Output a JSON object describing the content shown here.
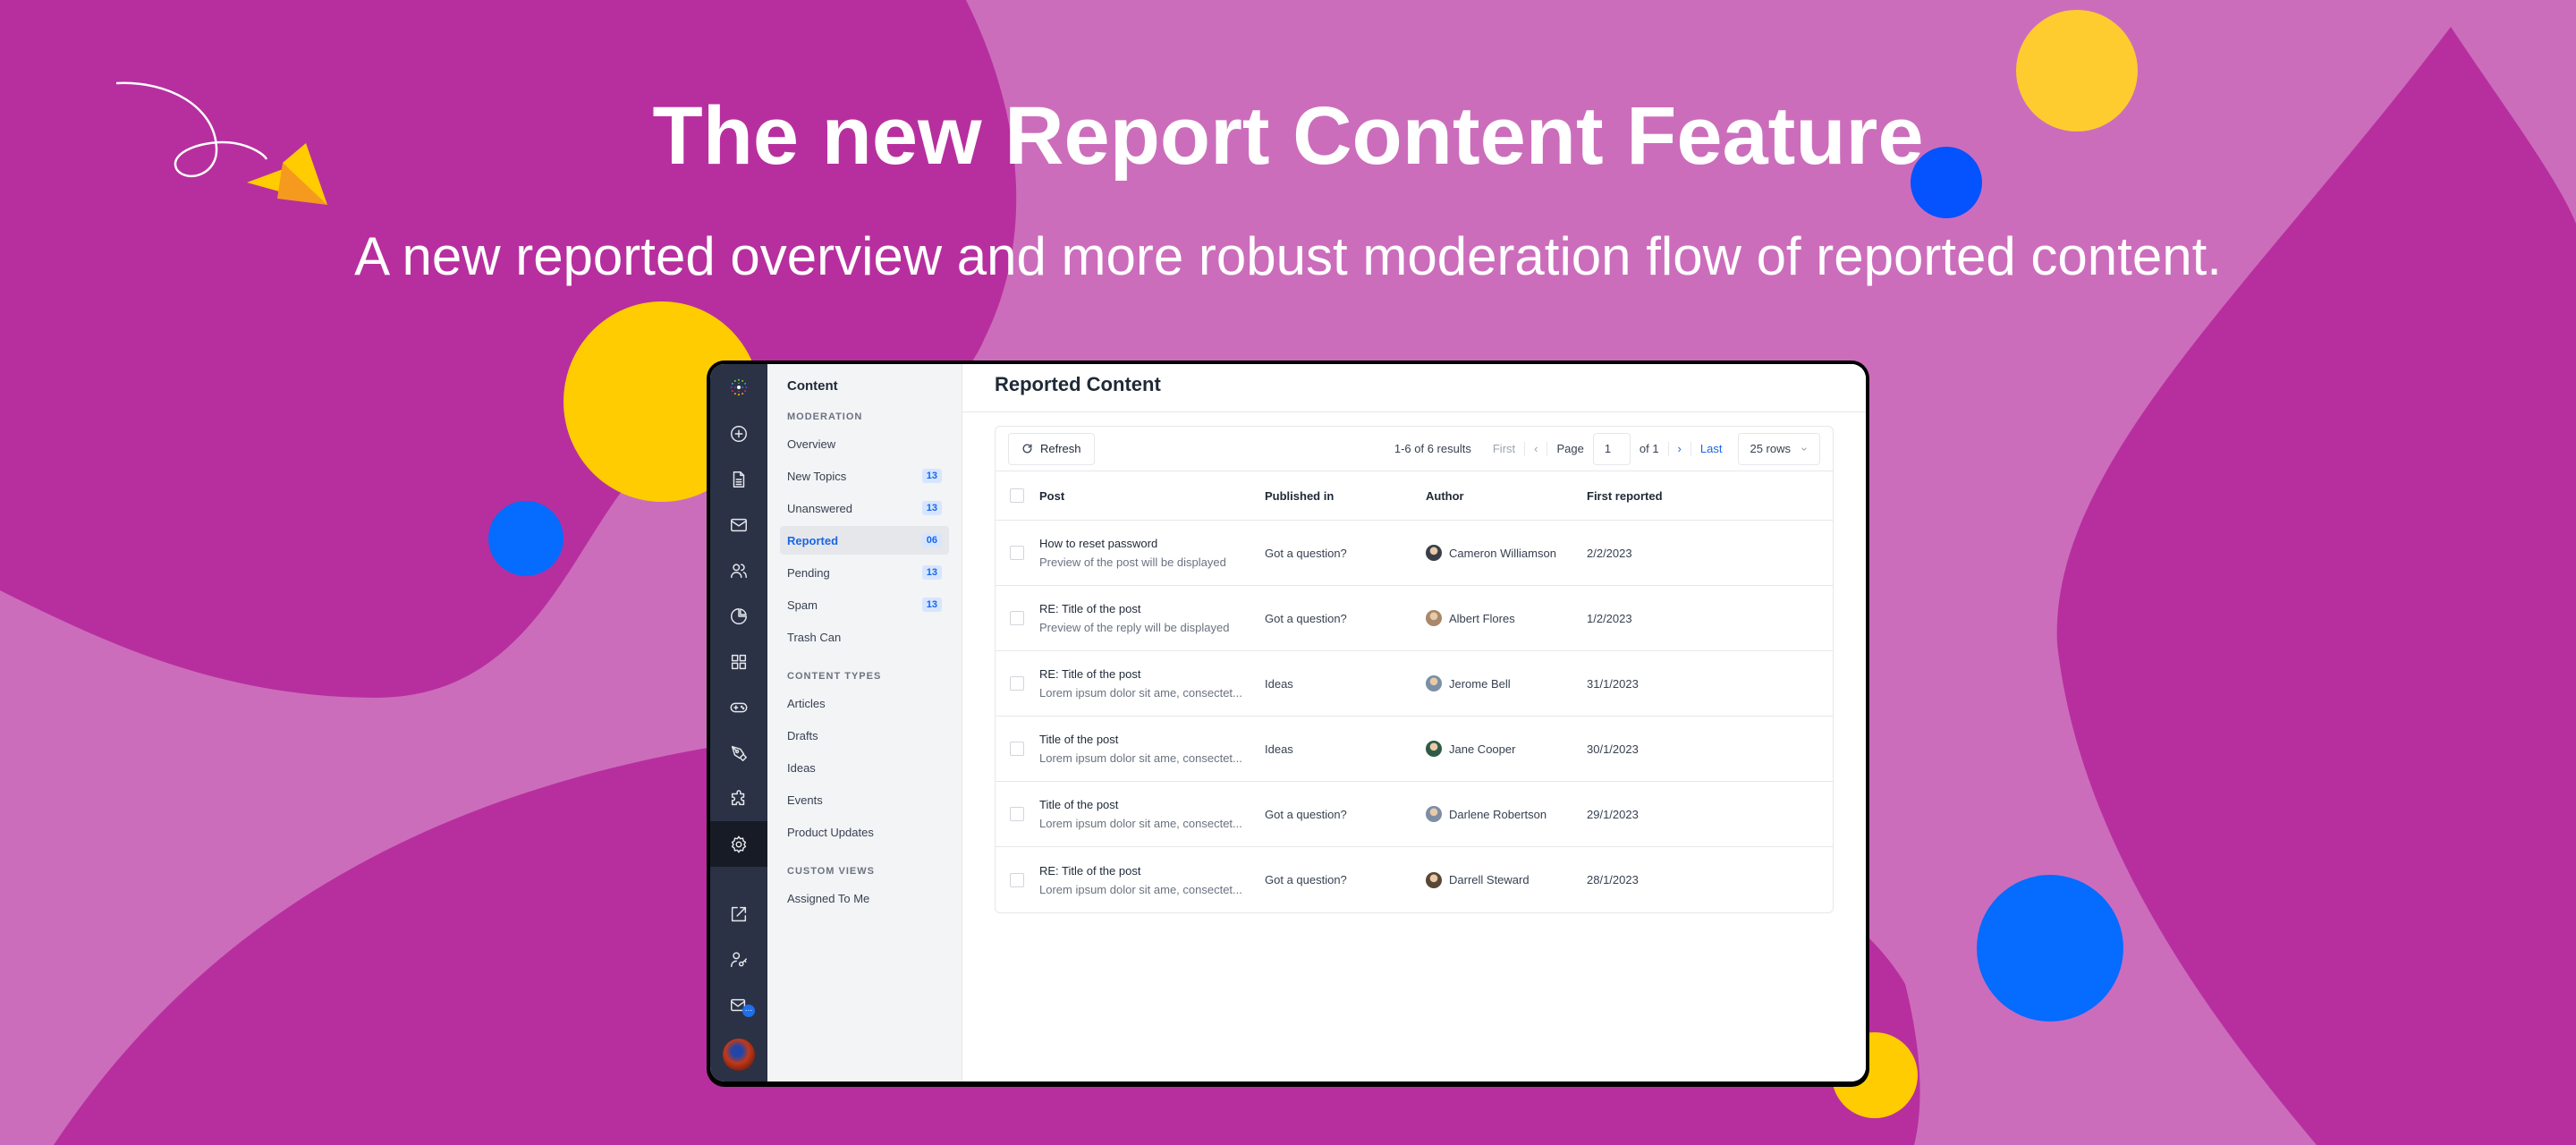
{
  "hero": {
    "title": "The new Report Content Feature",
    "subtitle": "A new reported overview and more robust moderation flow of reported content."
  },
  "colors": {
    "bg_light": "#cc6dbc",
    "bg_dark": "#b72f9e",
    "yellow": "#fecc00",
    "blue": "#0569ff",
    "accent": "#1a66e6"
  },
  "rail": {
    "icons": [
      "logo",
      "plus-circle-icon",
      "document-icon",
      "mail-icon",
      "users-icon",
      "pie-chart-icon",
      "grid-icon",
      "gamepad-icon",
      "pen-icon",
      "puzzle-icon",
      "gear-icon",
      "external-link-icon",
      "user-key-icon",
      "mail-chat-icon",
      "avatar"
    ],
    "active": "gear-icon",
    "mail_badge": "…"
  },
  "subnav": {
    "title": "Content",
    "sections": [
      {
        "label": "MODERATION",
        "items": [
          {
            "label": "Overview",
            "count": null
          },
          {
            "label": "New Topics",
            "count": "13"
          },
          {
            "label": "Unanswered",
            "count": "13"
          },
          {
            "label": "Reported",
            "count": "06",
            "active": true
          },
          {
            "label": "Pending",
            "count": "13"
          },
          {
            "label": "Spam",
            "count": "13"
          },
          {
            "label": "Trash Can",
            "count": null
          }
        ]
      },
      {
        "label": "CONTENT TYPES",
        "items": [
          {
            "label": "Articles"
          },
          {
            "label": "Drafts"
          },
          {
            "label": "Ideas"
          },
          {
            "label": "Events"
          },
          {
            "label": "Product Updates"
          }
        ]
      },
      {
        "label": "CUSTOM VIEWS",
        "items": [
          {
            "label": "Assigned To Me"
          }
        ]
      }
    ]
  },
  "main": {
    "title": "Reported Content",
    "refresh_label": "Refresh",
    "pager": {
      "results": "1-6 of 6 results",
      "first": "First",
      "prev": "‹",
      "page_label": "Page",
      "page_value": "1",
      "of": "of 1",
      "next": "›",
      "last": "Last",
      "rows": "25 rows"
    },
    "columns": [
      "Post",
      "Published in",
      "Author",
      "First reported"
    ],
    "rows": [
      {
        "title": "How to reset password",
        "preview": "Preview of the post will be displayed",
        "published_in": "Got a question?",
        "author": "Cameron Williamson",
        "date": "2/2/2023",
        "avatar_color": "#3a3f47"
      },
      {
        "title": "RE: Title of the post",
        "preview": "Preview of the reply will be displayed",
        "published_in": "Got a question?",
        "author": "Albert Flores",
        "date": "1/2/2023",
        "avatar_color": "#a8876a"
      },
      {
        "title": "RE: Title of the post",
        "preview": "Lorem ipsum dolor sit ame, consectet...",
        "published_in": "Ideas",
        "author": "Jerome Bell",
        "date": "31/1/2023",
        "avatar_color": "#7b8fa6"
      },
      {
        "title": "Title of the post",
        "preview": "Lorem ipsum dolor sit ame, consectet...",
        "published_in": "Ideas",
        "author": "Jane Cooper",
        "date": "30/1/2023",
        "avatar_color": "#2f5b46"
      },
      {
        "title": "Title of the post",
        "preview": "Lorem ipsum dolor sit ame, consectet...",
        "published_in": "Got a question?",
        "author": "Darlene Robertson",
        "date": "29/1/2023",
        "avatar_color": "#7d8da3"
      },
      {
        "title": "RE: Title of the post",
        "preview": "Lorem ipsum dolor sit ame, consectet...",
        "published_in": "Got a question?",
        "author": "Darrell Steward",
        "date": "28/1/2023",
        "avatar_color": "#5a4634"
      }
    ]
  }
}
